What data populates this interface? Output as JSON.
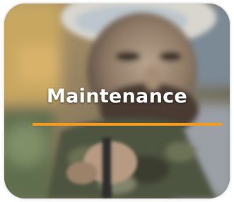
{
  "card": {
    "title": "Maintenance",
    "accent_color": "#f39a1f",
    "image_subject": "technician-photo"
  }
}
